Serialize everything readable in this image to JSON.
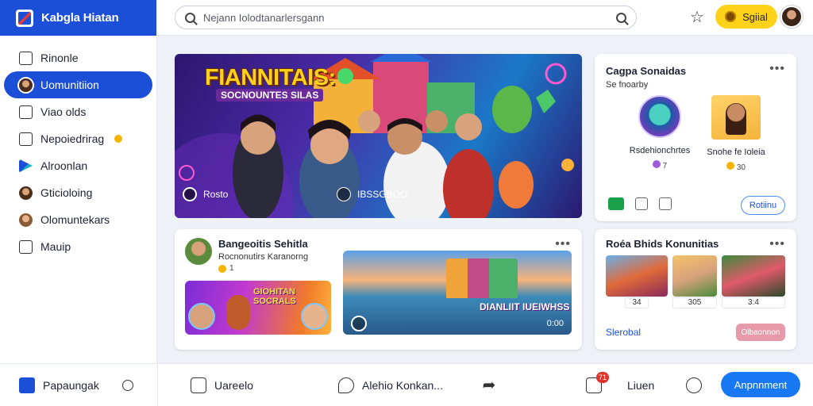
{
  "brand": {
    "name": "Kabgla Hiatan"
  },
  "search": {
    "placeholder": "Nejann Iolodtanarlersgann"
  },
  "header": {
    "pro_label": "Sgiial"
  },
  "sidebar": {
    "items": [
      {
        "label": "Rinonle",
        "icon": "home-icon"
      },
      {
        "label": "Uomunitiion",
        "icon": "community-avatar-icon",
        "active": true
      },
      {
        "label": "Viao olds",
        "icon": "video-icon"
      },
      {
        "label": "Nepoiedrirag",
        "icon": "news-icon"
      },
      {
        "label": "Alroonlan",
        "icon": "play-icon"
      },
      {
        "label": "Gticioloing",
        "icon": "avatar-icon"
      },
      {
        "label": "Olomuntekars",
        "icon": "avatar-icon"
      },
      {
        "label": "Mauip",
        "icon": "map-icon"
      }
    ]
  },
  "hero": {
    "title": "FIANNITAIS:",
    "subtitle": "SOCNOUNTES SILAS",
    "label": "Rosto",
    "time": "IBSSGBOO"
  },
  "suggestions": {
    "title": "Cagpa Sonaidas",
    "subtitle": "Se fnoarby",
    "people": [
      {
        "name": "Rsdehionchrtes",
        "meta": "7"
      },
      {
        "name": "Snohe fe Ioleia",
        "meta": "30"
      }
    ],
    "follow_label": "Rotiinu"
  },
  "post": {
    "author": "Bangeoitis Sehitla",
    "subtitle": "Rocnonutirs Karanorng",
    "reactions": "1",
    "image1_text": "GIOHITAN SOCRALS",
    "image2_text": "DIANLIIT IUEIWHSS",
    "image2_time": "0:00"
  },
  "recommended": {
    "title": "Roéa Bhids Konunitias",
    "counts": [
      "34",
      "305",
      "3:4"
    ],
    "link": "Slerobal",
    "button": "Olbaonnon"
  },
  "bottombar": {
    "brand_label": "Papaungak",
    "updates_label": "Uareelo",
    "message_label": "Alehio Konkan...",
    "notif_badge": "71",
    "green_label": "Liuen",
    "join_label": "Anpnnment"
  }
}
